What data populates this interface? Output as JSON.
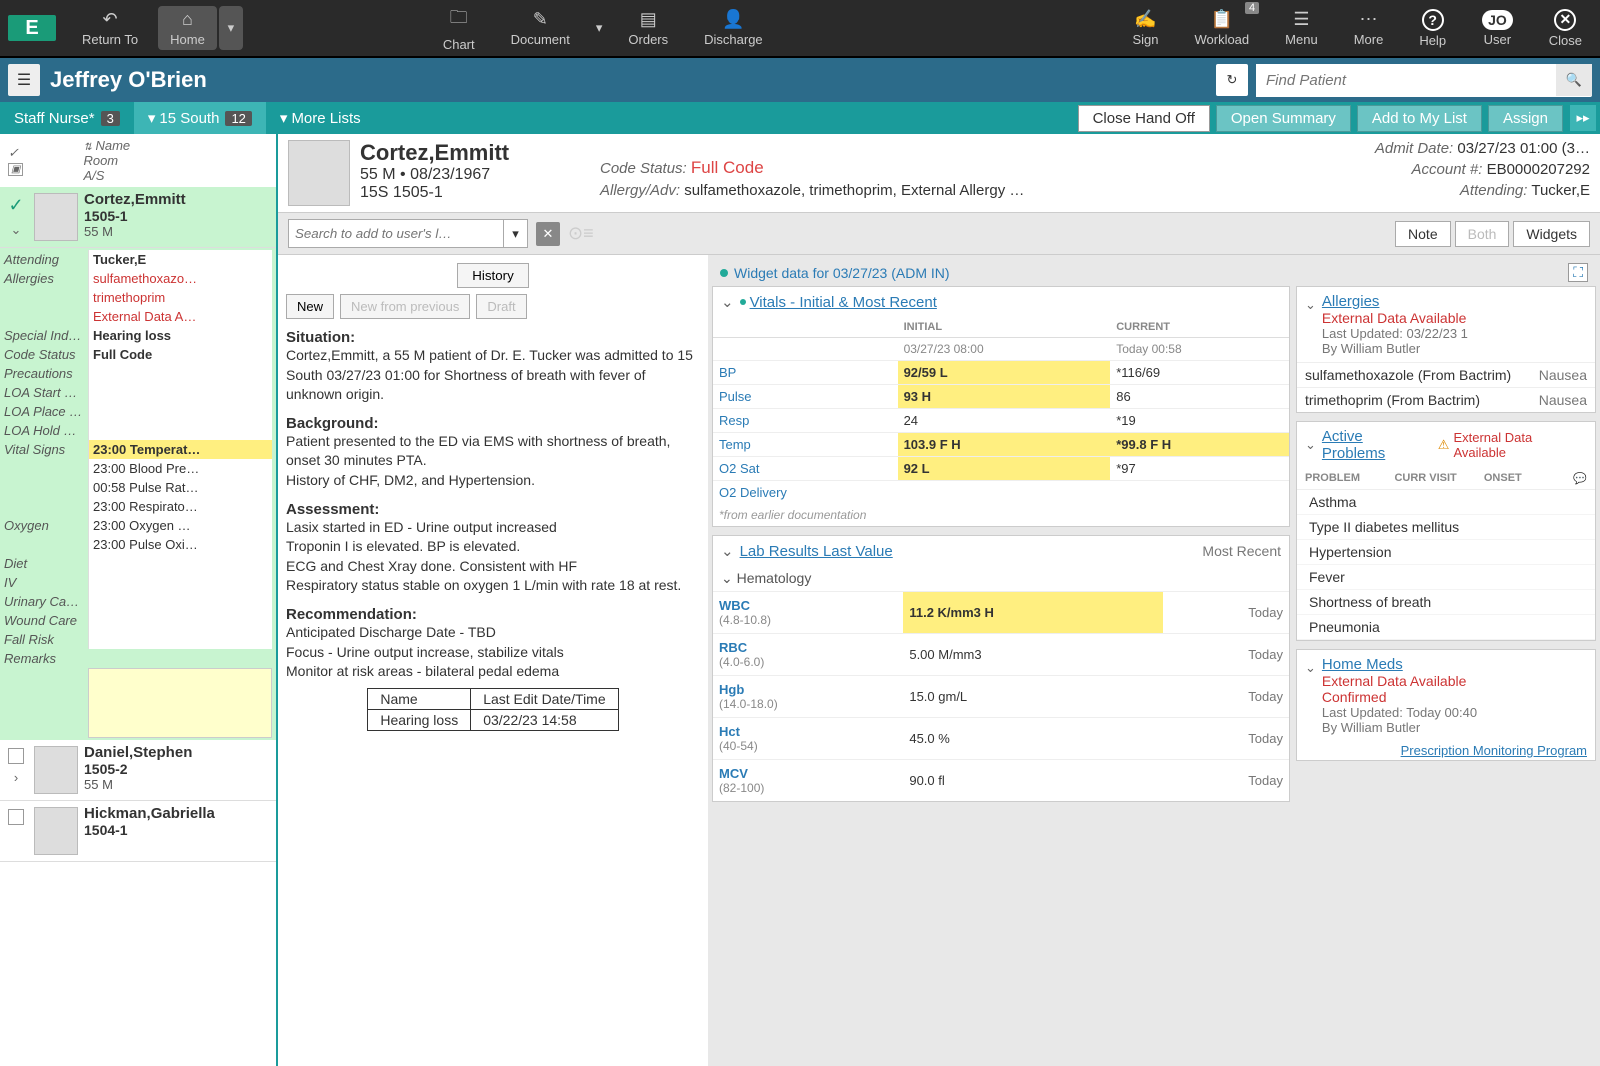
{
  "top": {
    "logo": "E",
    "return_to": "Return To",
    "home": "Home",
    "chart": "Chart",
    "document": "Document",
    "orders": "Orders",
    "discharge": "Discharge",
    "sign": "Sign",
    "workload": "Workload",
    "workload_badge": "4",
    "menu": "Menu",
    "more": "More",
    "help": "Help",
    "user_badge": "JO",
    "user": "User",
    "close": "Close"
  },
  "patientBar": {
    "name": "Jeffrey O'Brien",
    "search_placeholder": "Find Patient"
  },
  "tabs": {
    "staff_nurse": "Staff Nurse*",
    "staff_nurse_count": "3",
    "fifteen_south": "15 South",
    "fifteen_south_count": "12",
    "more_lists": "More Lists"
  },
  "actions": {
    "close_handoff": "Close Hand Off",
    "open_summary": "Open Summary",
    "add_list": "Add to My List",
    "assign": "Assign"
  },
  "listHeader": {
    "name": "Name",
    "room": "Room",
    "as": "A/S"
  },
  "patients": [
    {
      "name": "Cortez,Emmitt",
      "room": "1505-1",
      "age": "55 M"
    },
    {
      "name": "Daniel,Stephen",
      "room": "1505-2",
      "age": "55 M"
    },
    {
      "name": "Hickman,Gabriella",
      "room": "1504-1",
      "age": ""
    }
  ],
  "details": {
    "attending_label": "Attending",
    "attending": "Tucker,E",
    "allergies_label": "Allergies",
    "allergies": [
      "sulfamethoxazo…",
      "trimethoprim",
      "External Data A…"
    ],
    "special_label": "Special Ind…",
    "special": "Hearing loss",
    "code_label": "Code Status",
    "code": "Full Code",
    "precautions_label": "Precautions",
    "loa_start_label": "LOA Start …",
    "loa_place_label": "LOA Place …",
    "loa_hold_label": "LOA Hold …",
    "vitals_label": "Vital Signs",
    "vitals": [
      "23:00 Temperat…",
      "23:00 Blood Pre…",
      "00:58 Pulse Rat…",
      "23:00 Respirato…",
      "23:00 Oxygen …",
      "23:00 Pulse Oxi…"
    ],
    "oxygen_label": "Oxygen",
    "diet_label": "Diet",
    "iv_label": "IV",
    "urinary_label": "Urinary Ca…",
    "wound_label": "Wound Care",
    "fall_label": "Fall Risk",
    "remarks_label": "Remarks"
  },
  "ptHeader": {
    "name": "Cortez,Emmitt",
    "dem": "55 M • 08/23/1967",
    "loc": "15S 1505-1",
    "code_label": "Code Status:",
    "code": "Full Code",
    "allergy_label": "Allergy/Adv:",
    "allergy": "sulfamethoxazole, trimethoprim, External Allergy …",
    "admit_label": "Admit Date:",
    "admit": "03/27/23 01:00 (3…",
    "acct_label": "Account #:",
    "acct": "EB0000207292",
    "attending_label": "Attending:",
    "attending": "Tucker,E"
  },
  "actionRow": {
    "search_placeholder": "Search to add to user's l…",
    "note": "Note",
    "both": "Both",
    "widgets": "Widgets"
  },
  "note": {
    "history": "History",
    "new": "New",
    "new_prev": "New from previous",
    "draft": "Draft",
    "situation_head": "Situation:",
    "situation_text": "Cortez,Emmitt, a 55 M patient of Dr. E. Tucker was admitted to 15 South 03/27/23 01:00 for Shortness of breath with fever of unknown origin.",
    "background_head": "Background:",
    "background_text": "Patient presented to the ED via EMS with shortness of breath, onset 30 minutes PTA.\nHistory of CHF, DM2, and Hypertension.",
    "assessment_head": "Assessment:",
    "assessment_text": "Lasix started in ED - Urine output increased\nTroponin I is elevated. BP is elevated.\nECG and Chest Xray done. Consistent with HF\nRespiratory status stable on oxygen 1 L/min with rate 18 at rest.",
    "rec_head": "Recommendation:",
    "rec_text": "Anticipated Discharge Date - TBD\nFocus - Urine output increase, stabilize vitals\nMonitor at risk areas - bilateral pedal edema",
    "table": {
      "h1": "Name",
      "h2": "Last Edit Date/Time",
      "r1": "Hearing loss",
      "r2": "03/22/23 14:58"
    }
  },
  "widgetBanner": "Widget data for 03/27/23 (ADM IN)",
  "vitalsWidget": {
    "title": "Vitals - Initial & Most Recent",
    "col_initial": "INITIAL",
    "col_current": "CURRENT",
    "init_time": "03/27/23 08:00",
    "curr_time": "Today 00:58",
    "rows": [
      {
        "label": "BP",
        "init": "92/59 L",
        "init_hl": true,
        "curr": "*116/69",
        "curr_hl": false
      },
      {
        "label": "Pulse",
        "init": "93 H",
        "init_hl": true,
        "curr": "86",
        "curr_hl": false
      },
      {
        "label": "Resp",
        "init": "24",
        "init_hl": false,
        "curr": "*19",
        "curr_hl": false
      },
      {
        "label": "Temp",
        "init": "103.9 F H",
        "init_hl": true,
        "curr": "*99.8 F H",
        "curr_hl": true
      },
      {
        "label": "O2 Sat",
        "init": "92 L",
        "init_hl": true,
        "curr": "*97",
        "curr_hl": false
      },
      {
        "label": "O2 Delivery",
        "init": "",
        "init_hl": false,
        "curr": "",
        "curr_hl": false
      }
    ],
    "footnote": "*from earlier documentation"
  },
  "labWidget": {
    "title": "Lab Results Last Value",
    "subtitle": "Most Recent",
    "section": "Hematology",
    "rows": [
      {
        "name": "WBC",
        "range": "(4.8-10.8)",
        "val": "11.2 K/mm3 H",
        "hl": true,
        "time": "Today"
      },
      {
        "name": "RBC",
        "range": "(4.0-6.0)",
        "val": "5.00 M/mm3",
        "hl": false,
        "time": "Today"
      },
      {
        "name": "Hgb",
        "range": "(14.0-18.0)",
        "val": "15.0 gm/L",
        "hl": false,
        "time": "Today"
      },
      {
        "name": "Hct",
        "range": "(40-54)",
        "val": "45.0 %",
        "hl": false,
        "time": "Today"
      },
      {
        "name": "MCV",
        "range": "(82-100)",
        "val": "90.0 fl",
        "hl": false,
        "time": "Today"
      }
    ]
  },
  "allergyWidget": {
    "title": "Allergies",
    "red": "External Data Available",
    "sub1": "Last Updated: 03/22/23 1",
    "sub2": "By William Butler",
    "rows": [
      {
        "drug": "sulfamethoxazole (From Bactrim)",
        "react": "Nausea"
      },
      {
        "drug": "trimethoprim (From Bactrim)",
        "react": "Nausea"
      }
    ]
  },
  "probWidget": {
    "title": "Active Problems",
    "warn": "External Data Available",
    "col1": "PROBLEM",
    "col2": "CURR VISIT",
    "col3": "ONSET",
    "rows": [
      "Asthma",
      "Type II diabetes mellitus",
      "Hypertension",
      "Fever",
      "Shortness of breath",
      "Pneumonia"
    ]
  },
  "medsWidget": {
    "title": "Home Meds",
    "red": "External Data Available",
    "confirmed": "Confirmed",
    "sub1": "Last Updated: Today 00:40",
    "sub2": "By William Butler",
    "link": "Prescription Monitoring Program"
  }
}
